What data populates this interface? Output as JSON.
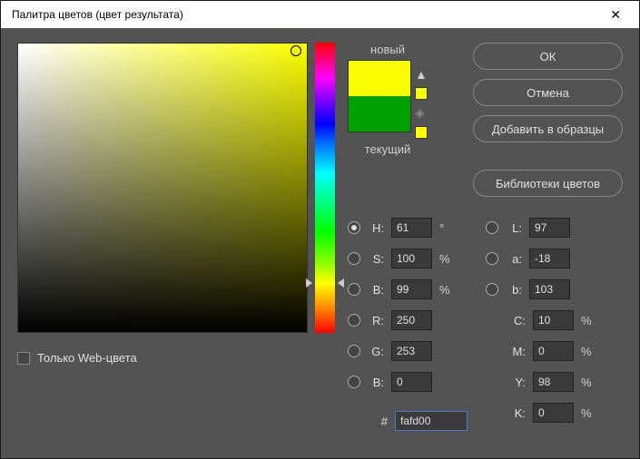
{
  "title": "Палитра цветов (цвет результата)",
  "swatch": {
    "new_label": "новый",
    "current_label": "текущий"
  },
  "buttons": {
    "ok": "ОК",
    "cancel": "Отмена",
    "add": "Добавить в образцы",
    "libs": "Библиотеки цветов"
  },
  "web_only_label": "Только Web-цвета",
  "hsb": {
    "h_label": "H:",
    "h_value": "61",
    "h_unit": "°",
    "s_label": "S:",
    "s_value": "100",
    "s_unit": "%",
    "b_label": "B:",
    "b_value": "99",
    "b_unit": "%"
  },
  "rgb": {
    "r_label": "R:",
    "r_value": "250",
    "g_label": "G:",
    "g_value": "253",
    "b_label": "B:",
    "b_value": "0"
  },
  "lab": {
    "l_label": "L:",
    "l_value": "97",
    "a_label": "a:",
    "a_value": "-18",
    "b_label": "b:",
    "b_value": "103"
  },
  "cmyk": {
    "c_label": "C:",
    "c_value": "10",
    "c_unit": "%",
    "m_label": "M:",
    "m_value": "0",
    "m_unit": "%",
    "y_label": "Y:",
    "y_value": "98",
    "y_unit": "%",
    "k_label": "K:",
    "k_value": "0",
    "k_unit": "%"
  },
  "hex": {
    "label": "#",
    "value": "fafd00"
  },
  "colors": {
    "new": "#fafd00",
    "current": "#00a000"
  }
}
